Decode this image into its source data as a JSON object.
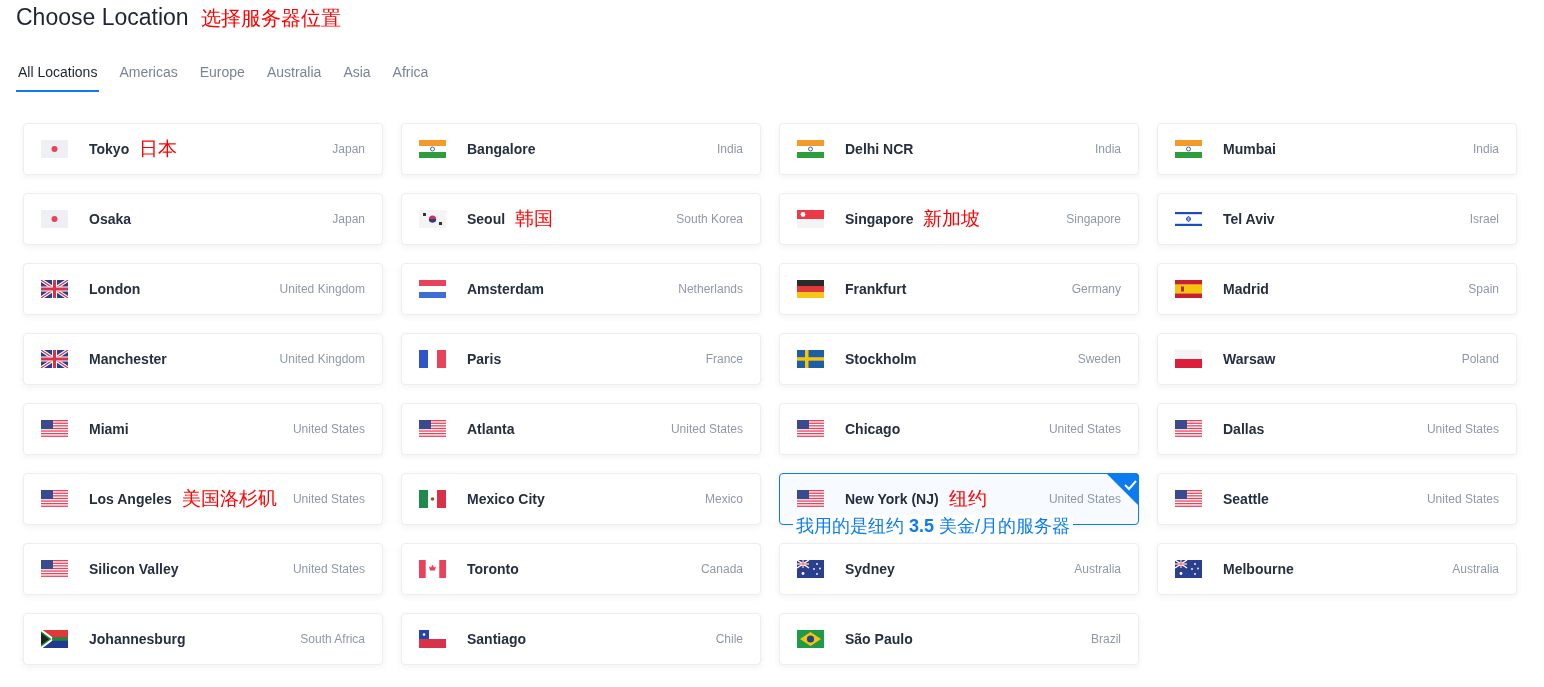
{
  "title": "Choose Location",
  "title_note": "选择服务器位置",
  "tabs": [
    {
      "label": "All Locations",
      "selected": true
    },
    {
      "label": "Americas",
      "selected": false
    },
    {
      "label": "Europe",
      "selected": false
    },
    {
      "label": "Australia",
      "selected": false
    },
    {
      "label": "Asia",
      "selected": false
    },
    {
      "label": "Africa",
      "selected": false
    }
  ],
  "locations": [
    {
      "kind": "jp",
      "city": "Tokyo",
      "note": "日本",
      "country": "Japan",
      "selected": false
    },
    {
      "kind": "in",
      "city": "Bangalore",
      "country": "India",
      "selected": false
    },
    {
      "kind": "in",
      "city": "Delhi NCR",
      "country": "India",
      "selected": false
    },
    {
      "kind": "in",
      "city": "Mumbai",
      "country": "India",
      "selected": false
    },
    {
      "kind": "jp",
      "city": "Osaka",
      "country": "Japan",
      "selected": false
    },
    {
      "kind": "kr",
      "city": "Seoul",
      "note": "韩国",
      "country": "South Korea",
      "selected": false
    },
    {
      "kind": "sg",
      "city": "Singapore",
      "note": "新加坡",
      "country": "Singapore",
      "selected": false
    },
    {
      "kind": "il",
      "city": "Tel Aviv",
      "country": "Israel",
      "selected": false
    },
    {
      "kind": "gb",
      "city": "London",
      "country": "United Kingdom",
      "selected": false
    },
    {
      "kind": "nl",
      "city": "Amsterdam",
      "country": "Netherlands",
      "selected": false
    },
    {
      "kind": "de",
      "city": "Frankfurt",
      "country": "Germany",
      "selected": false
    },
    {
      "kind": "es",
      "city": "Madrid",
      "country": "Spain",
      "selected": false
    },
    {
      "kind": "gb",
      "city": "Manchester",
      "country": "United Kingdom",
      "selected": false
    },
    {
      "kind": "fr",
      "city": "Paris",
      "country": "France",
      "selected": false
    },
    {
      "kind": "se",
      "city": "Stockholm",
      "country": "Sweden",
      "selected": false
    },
    {
      "kind": "pl",
      "city": "Warsaw",
      "country": "Poland",
      "selected": false
    },
    {
      "kind": "us",
      "city": "Miami",
      "country": "United States",
      "selected": false
    },
    {
      "kind": "us",
      "city": "Atlanta",
      "country": "United States",
      "selected": false
    },
    {
      "kind": "us",
      "city": "Chicago",
      "country": "United States",
      "selected": false
    },
    {
      "kind": "us",
      "city": "Dallas",
      "country": "United States",
      "selected": false
    },
    {
      "kind": "us",
      "city": "Los Angeles",
      "note": "美国洛杉矶",
      "country": "United States",
      "selected": false
    },
    {
      "kind": "mx",
      "city": "Mexico City",
      "country": "Mexico",
      "selected": false
    },
    {
      "kind": "us",
      "city": "New York (NJ)",
      "note": "纽约",
      "country": "United States",
      "selected": true,
      "caption": "我用的是纽约 **3.5** 美金/月的服务器"
    },
    {
      "kind": "us",
      "city": "Seattle",
      "country": "United States",
      "selected": false
    },
    {
      "kind": "us",
      "city": "Silicon Valley",
      "country": "United States",
      "selected": false
    },
    {
      "kind": "ca",
      "city": "Toronto",
      "country": "Canada",
      "selected": false
    },
    {
      "kind": "au",
      "city": "Sydney",
      "country": "Australia",
      "selected": false
    },
    {
      "kind": "au",
      "city": "Melbourne",
      "country": "Australia",
      "selected": false
    },
    {
      "kind": "za",
      "city": "Johannesburg",
      "country": "South Africa",
      "selected": false
    },
    {
      "kind": "cl",
      "city": "Santiago",
      "country": "Chile",
      "selected": false
    },
    {
      "kind": "br",
      "city": "São Paulo",
      "country": "Brazil",
      "selected": false
    }
  ]
}
